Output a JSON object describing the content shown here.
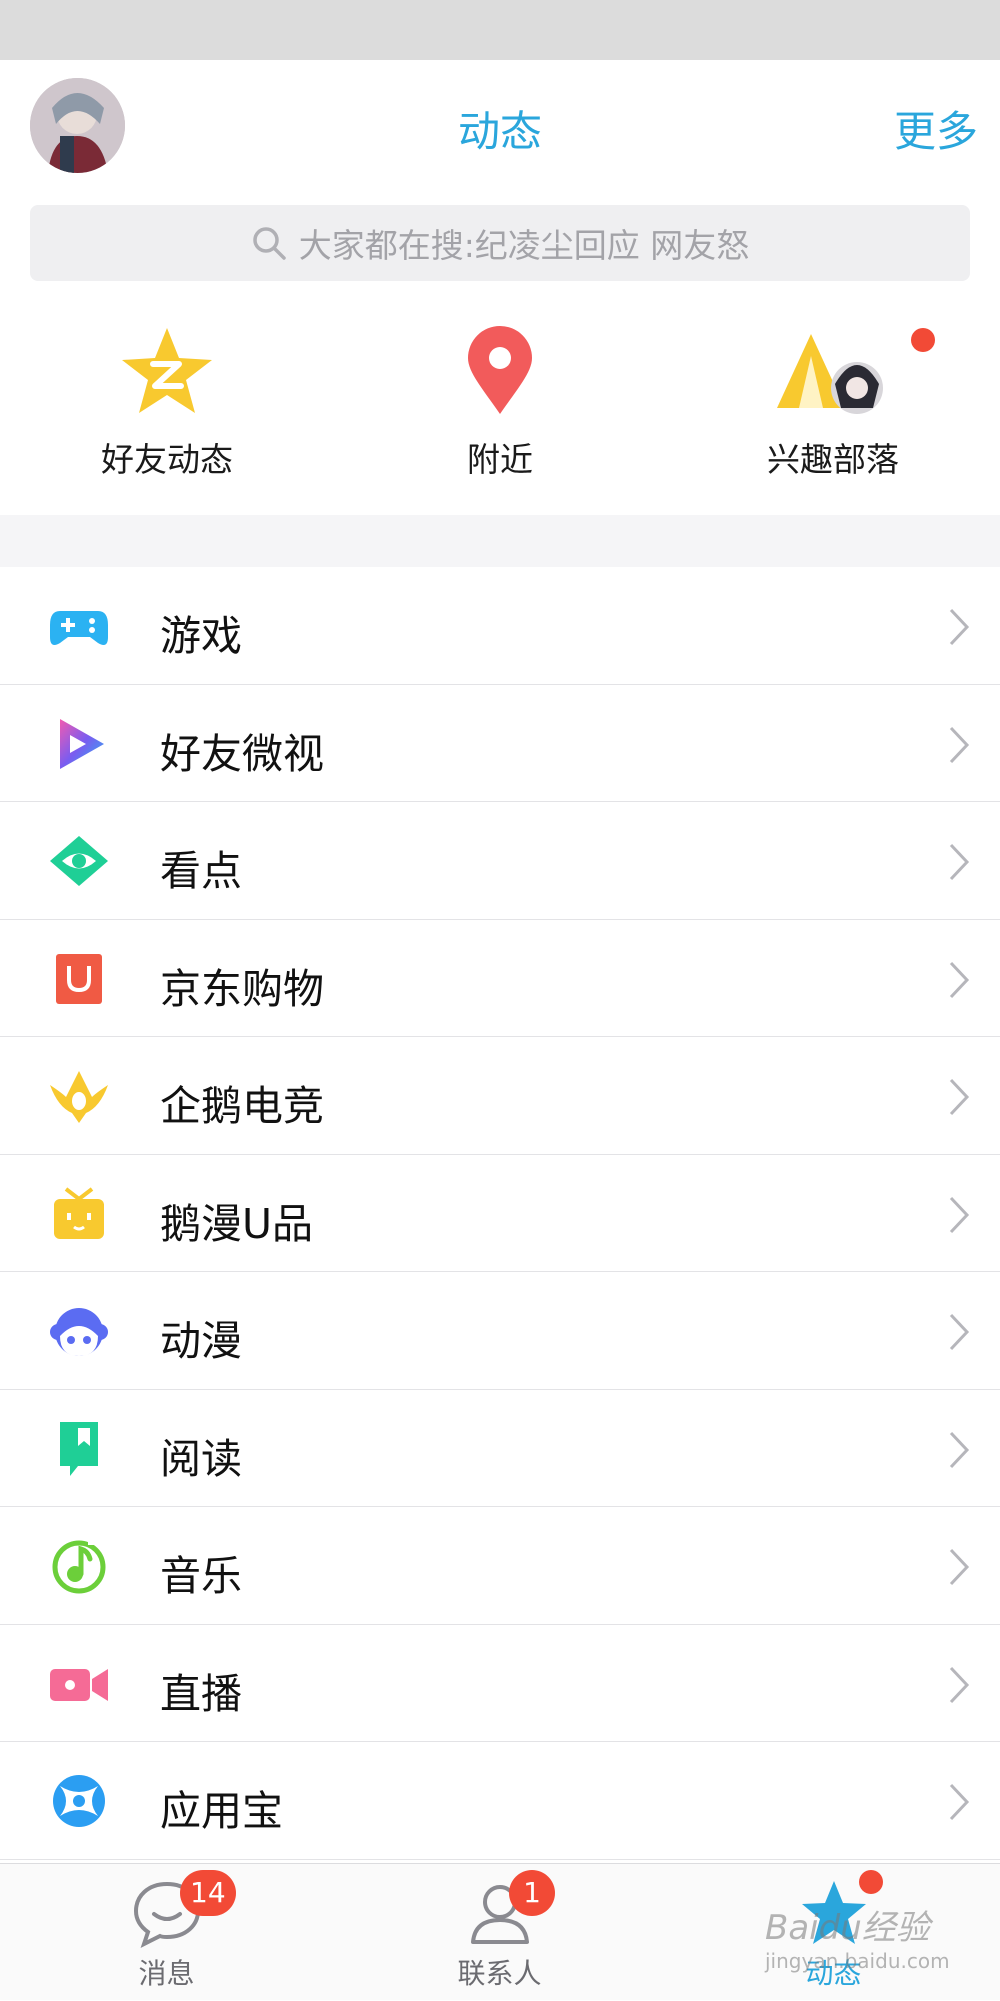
{
  "header": {
    "title": "动态",
    "more_label": "更多"
  },
  "search": {
    "placeholder": "大家都在搜:纪凌尘回应 网友怒"
  },
  "quick_links": [
    {
      "label": "好友动态",
      "icon": "star-z-icon",
      "color": "#f8c92f"
    },
    {
      "label": "附近",
      "icon": "location-pin-icon",
      "color": "#f25b5b"
    },
    {
      "label": "兴趣部落",
      "icon": "tent-icon",
      "color": "#f8c92f"
    }
  ],
  "menu": [
    {
      "label": "游戏",
      "icon": "gamepad-icon",
      "color": "#2bb2f2"
    },
    {
      "label": "好友微视",
      "icon": "play-triangle-icon",
      "color": "#7a5cf0"
    },
    {
      "label": "看点",
      "icon": "eye-icon",
      "color": "#1fcf96"
    },
    {
      "label": "京东购物",
      "icon": "shopping-u-icon",
      "color": "#f05a44"
    },
    {
      "label": "企鹅电竞",
      "icon": "crown-icon",
      "color": "#f8c92f"
    },
    {
      "label": "鹅漫U品",
      "icon": "gift-box-icon",
      "color": "#f8c92f"
    },
    {
      "label": "动漫",
      "icon": "anime-face-icon",
      "color": "#5b6cf2"
    },
    {
      "label": "阅读",
      "icon": "bookmark-icon",
      "color": "#1fcf96"
    },
    {
      "label": "音乐",
      "icon": "music-note-icon",
      "color": "#6ccf3a"
    },
    {
      "label": "直播",
      "icon": "video-camera-icon",
      "color": "#f56b96"
    },
    {
      "label": "应用宝",
      "icon": "app-store-icon",
      "color": "#2b9ef2"
    }
  ],
  "tabbar": [
    {
      "label": "消息",
      "badge": "14",
      "icon": "chat-bubble-icon"
    },
    {
      "label": "联系人",
      "badge": "1",
      "icon": "contacts-icon"
    },
    {
      "label": "动态",
      "icon": "star-icon",
      "active": true
    }
  ],
  "watermark": {
    "text": "Baidu经验",
    "sub": "jingyan.baidu.com"
  }
}
